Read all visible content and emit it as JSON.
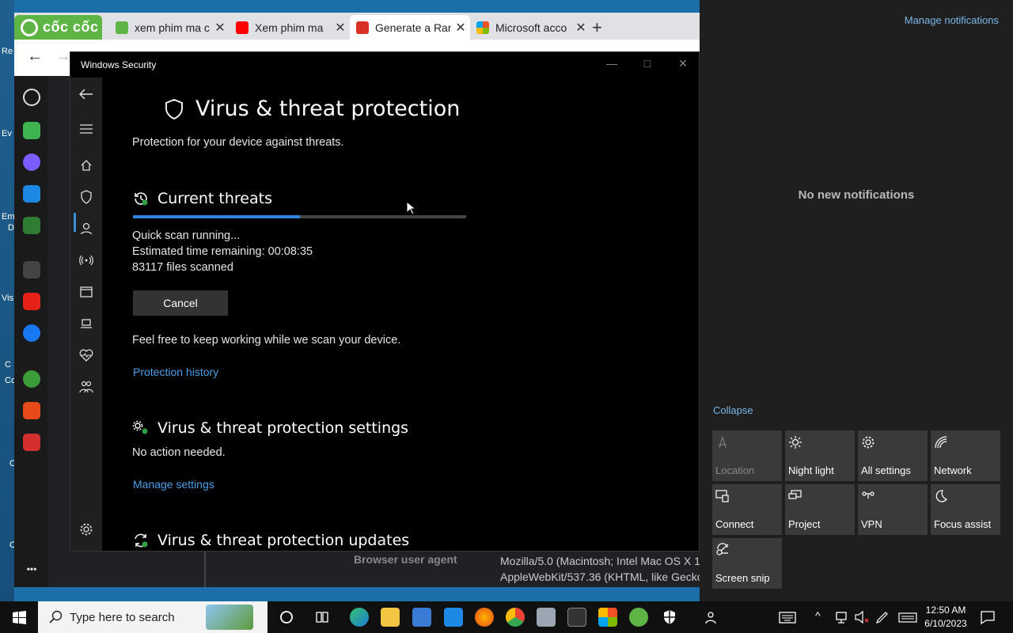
{
  "desktop": {
    "fragments": [
      "Re",
      "Ev",
      "Em",
      "D",
      "Vis",
      "C",
      "Co",
      "C",
      "C"
    ]
  },
  "browser": {
    "brand": "cốc cốc",
    "tabs": [
      {
        "label": "xem phim ma c",
        "active": false
      },
      {
        "label": "Xem phim ma",
        "active": false
      },
      {
        "label": "Generate a Ran",
        "active": true
      },
      {
        "label": "Microsoft acco",
        "active": false
      }
    ],
    "tab_close": "✕",
    "new_tab": "+",
    "back": "←",
    "forward": "→",
    "ua_label": "Browser user agent",
    "ua_line1": "Mozilla/5.0 (Macintosh; Intel Mac OS X 1",
    "ua_line2": "AppleWebKit/537.36 (KHTML, like Gecko)",
    "rail_more": "•••"
  },
  "security": {
    "window_title": "Windows Security",
    "heading": "Virus & threat protection",
    "subheading": "Protection for your device against threats.",
    "current_threats": {
      "title": "Current threats",
      "progress": 0.5,
      "status": "Quick scan running...",
      "eta": "Estimated time remaining:  00:08:35",
      "files": "83117  files scanned",
      "cancel": "Cancel",
      "note": "Feel free to keep working while we scan your device.",
      "history_link": "Protection history"
    },
    "settings": {
      "title": "Virus & threat protection settings",
      "status": "No action needed.",
      "link": "Manage settings"
    },
    "updates": {
      "title": "Virus & threat protection updates"
    }
  },
  "action_center": {
    "manage": "Manage notifications",
    "empty": "No new notifications",
    "collapse": "Collapse",
    "tiles": [
      {
        "label": "Location",
        "icon": "location-icon",
        "enabled": false
      },
      {
        "label": "Night light",
        "icon": "sun-icon",
        "enabled": true
      },
      {
        "label": "All settings",
        "icon": "gear-icon",
        "enabled": true
      },
      {
        "label": "Network",
        "icon": "network-icon",
        "enabled": true
      },
      {
        "label": "Connect",
        "icon": "connect-icon",
        "enabled": true
      },
      {
        "label": "Project",
        "icon": "project-icon",
        "enabled": true
      },
      {
        "label": "VPN",
        "icon": "vpn-icon",
        "enabled": true
      },
      {
        "label": "Focus assist",
        "icon": "moon-icon",
        "enabled": true
      },
      {
        "label": "Screen snip",
        "icon": "snip-icon",
        "enabled": true
      }
    ]
  },
  "taskbar": {
    "search_placeholder": "Type here to search",
    "time": "12:50 AM",
    "date": "6/10/2023"
  }
}
